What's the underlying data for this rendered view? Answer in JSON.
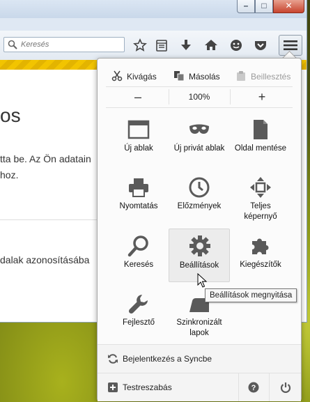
{
  "window_controls": {
    "minimize": "–",
    "maximize": "□",
    "close": "✕"
  },
  "search": {
    "placeholder": "Keresés",
    "icon": "search-icon"
  },
  "toolbar": {
    "icons": [
      "bookmark-star-icon",
      "reading-list-icon",
      "download-icon",
      "home-icon",
      "chat-icon",
      "pocket-icon"
    ],
    "menu_button_icon": "hamburger-menu-icon"
  },
  "page": {
    "heading": "os",
    "line1": "tta be. Az Ön adatain",
    "line2": "hoz.",
    "line3": "dalak azonosításába"
  },
  "panel": {
    "edit": {
      "cut": "Kivágás",
      "copy": "Másolás",
      "paste": "Beillesztés"
    },
    "zoom": {
      "minus": "–",
      "value": "100%",
      "plus": "+"
    },
    "items": [
      {
        "label": "Új ablak",
        "icon": "new-window-icon"
      },
      {
        "label": "Új privát ablak",
        "icon": "private-mask-icon"
      },
      {
        "label": "Oldal mentése",
        "icon": "save-page-icon"
      },
      {
        "label": "Nyomtatás",
        "icon": "printer-icon"
      },
      {
        "label": "Előzmények",
        "icon": "history-clock-icon"
      },
      {
        "label": "Teljes képernyő",
        "icon": "fullscreen-icon"
      },
      {
        "label": "Keresés",
        "icon": "magnifier-icon"
      },
      {
        "label": "Beállítások",
        "icon": "gear-icon"
      },
      {
        "label": "Kiegészítők",
        "icon": "puzzle-icon"
      },
      {
        "label": "Fejlesztő",
        "icon": "wrench-icon"
      },
      {
        "label": "Szinkronizált lapok",
        "icon": "synced-tabs-icon"
      }
    ],
    "sync_label": "Bejelentkezés a Syncbe",
    "customize_label": "Testreszabás",
    "help_icon": "help-icon",
    "quit_icon": "power-icon"
  },
  "tooltip": "Beállítások megnyitása",
  "colors": {
    "tab_accent": "#f2c400",
    "panel_bg": "#fbfbfb",
    "icon_gray": "#5a5a5a"
  }
}
